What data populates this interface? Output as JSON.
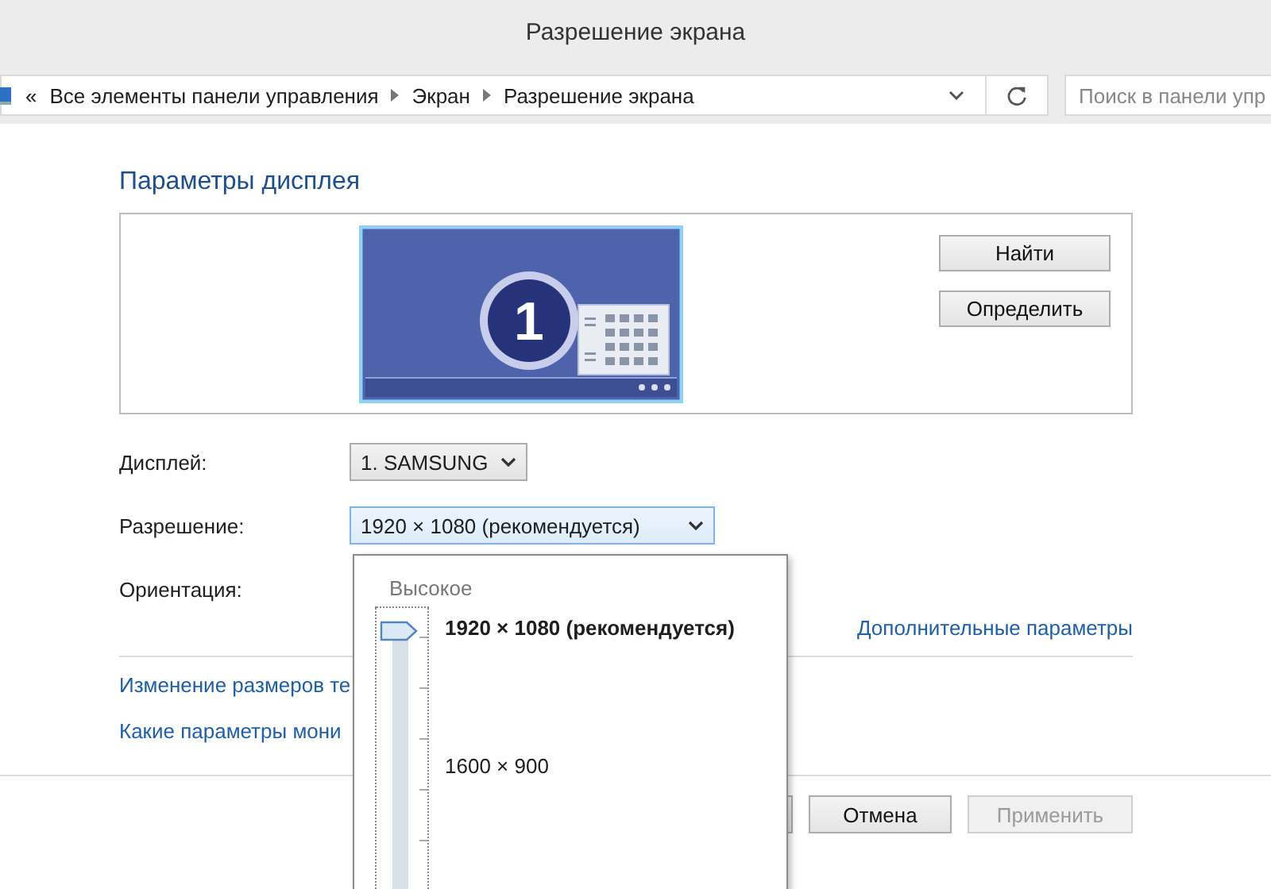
{
  "window": {
    "title": "Разрешение экрана"
  },
  "address_bar": {
    "prefix": "«",
    "path": [
      "Все элементы панели управления",
      "Экран",
      "Разрешение экрана"
    ]
  },
  "search": {
    "placeholder": "Поиск в панели упр"
  },
  "heading": "Параметры дисплея",
  "preview": {
    "monitor_number": "1",
    "buttons": [
      {
        "label": "Найти"
      },
      {
        "label": "Определить"
      }
    ]
  },
  "fields": [
    {
      "label": "Дисплей:",
      "value": "1. SAMSUNG",
      "focused": false
    },
    {
      "label": "Разрешение:",
      "value": "1920 × 1080 (рекомендуется)",
      "focused": true
    },
    {
      "label": "Ориентация:"
    }
  ],
  "advanced_link": "Дополнительные параметры",
  "links": [
    "Изменение размеров те",
    "Какие параметры мони"
  ],
  "resolution_popup": {
    "top_label": "Высокое",
    "level": 1,
    "options": [
      {
        "label": "1920 × 1080 (рекомендуется)",
        "selected": true
      },
      {
        "label": "1600 × 900",
        "selected": false
      }
    ]
  },
  "buttons": [
    {
      "label": "Отмена",
      "disabled": false
    },
    {
      "label": "Применить",
      "disabled": true
    }
  ]
}
